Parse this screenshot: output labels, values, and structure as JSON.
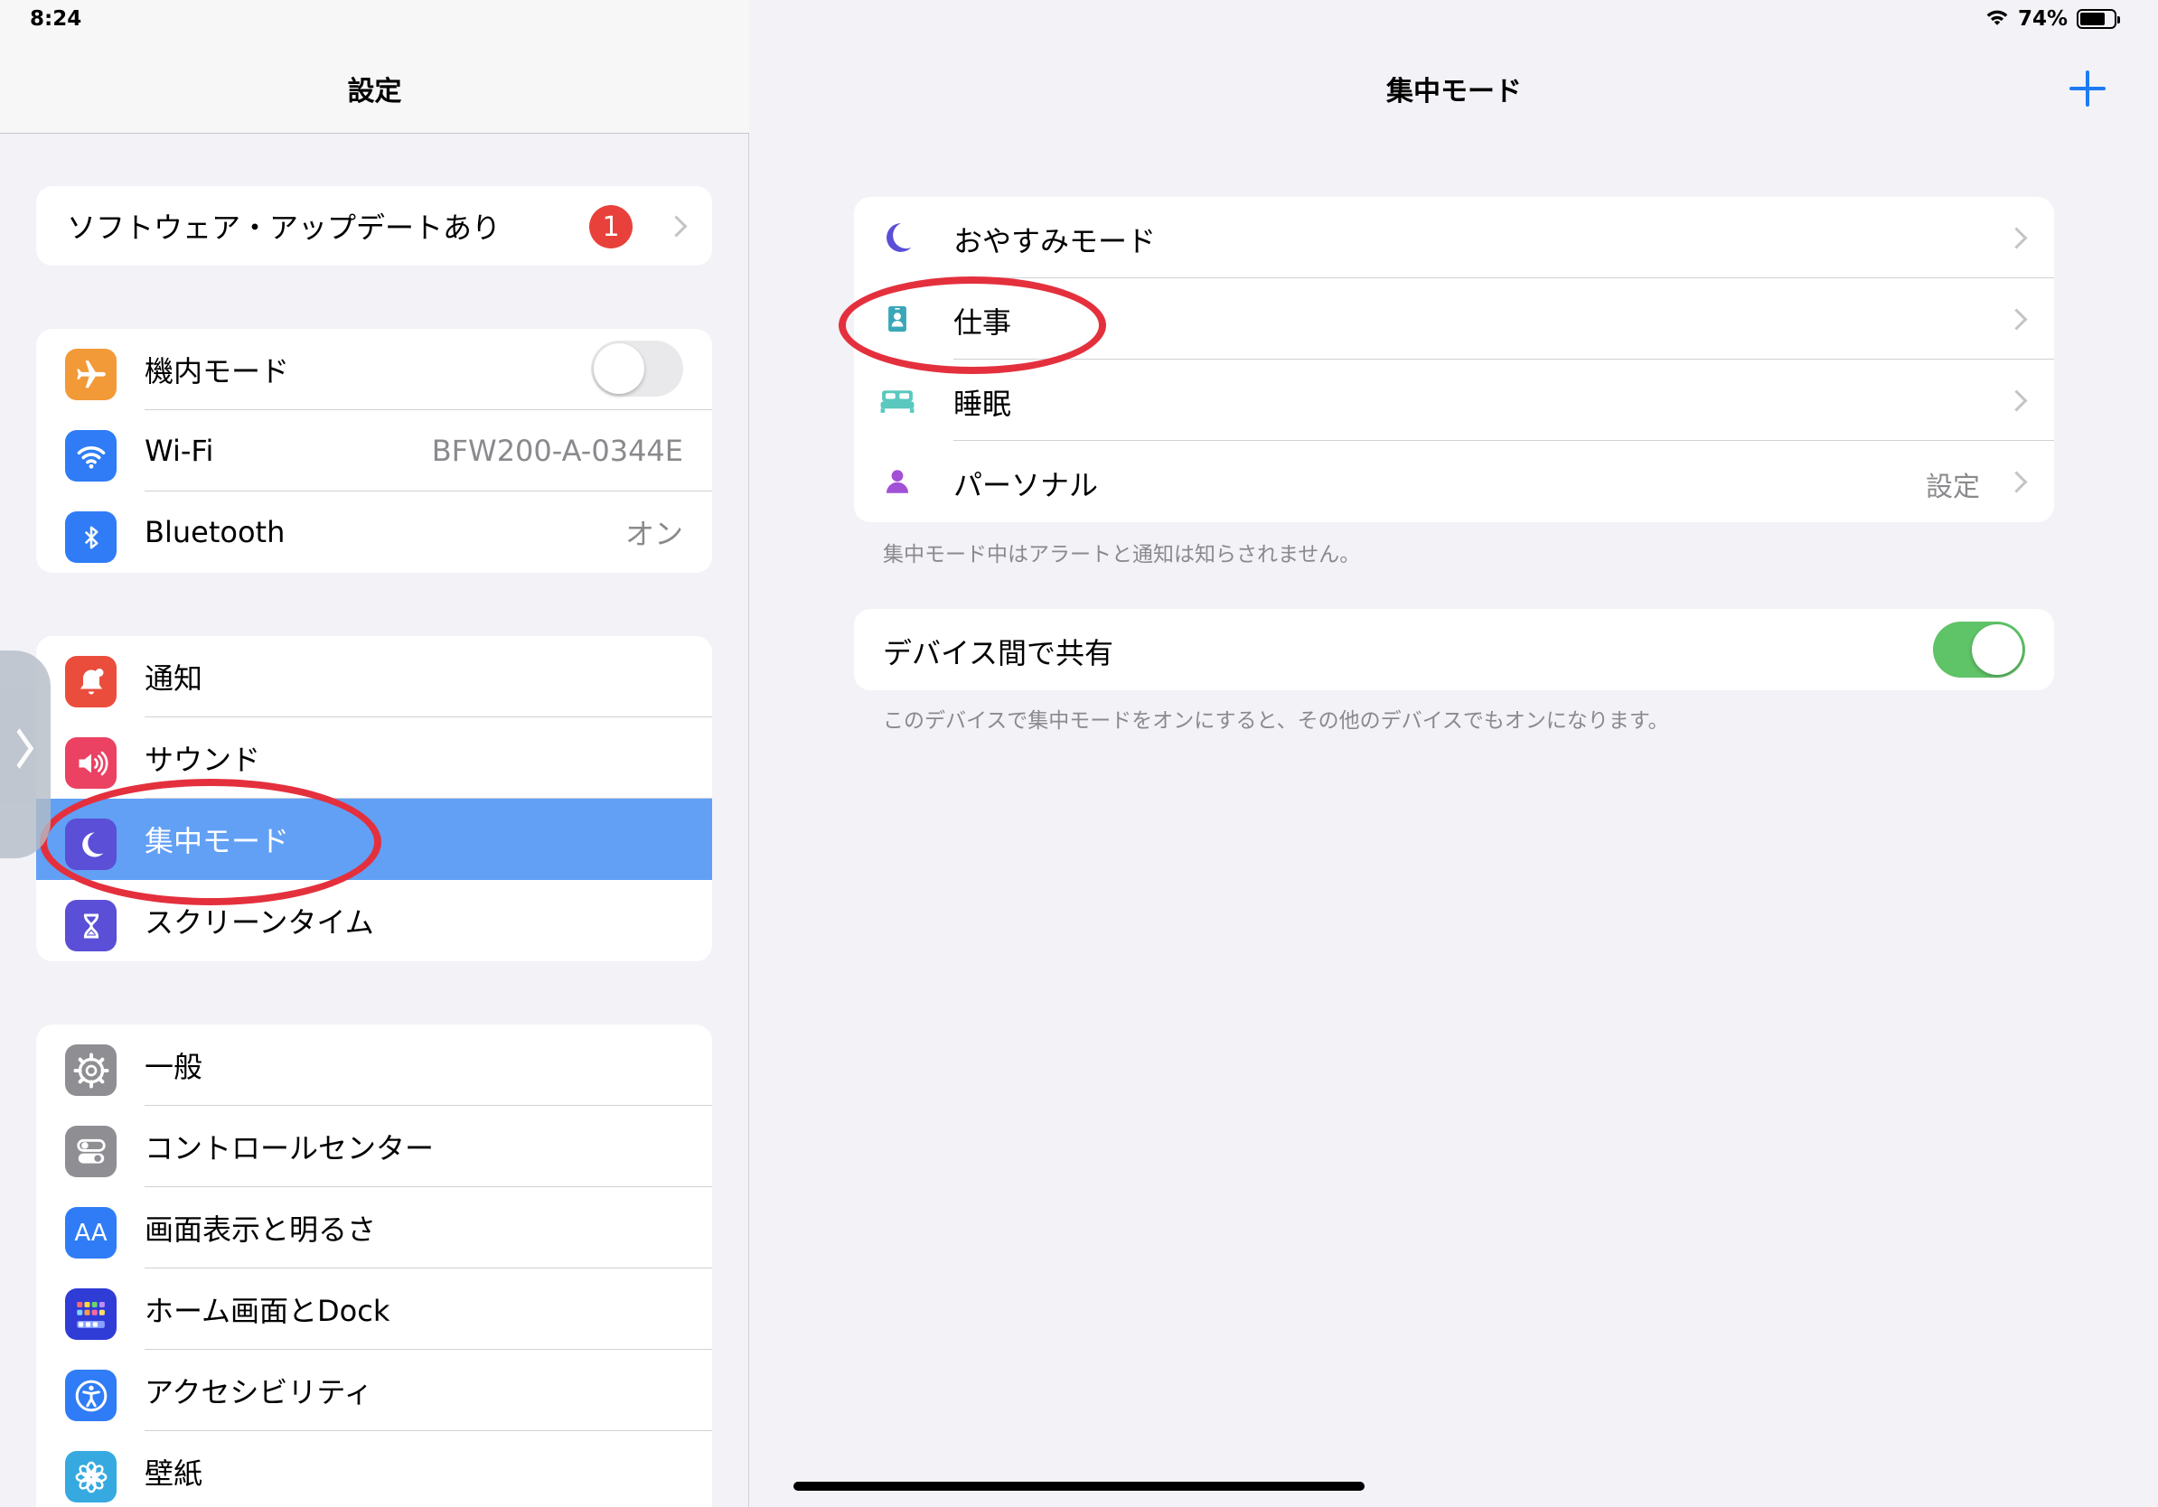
{
  "status": {
    "time": "8:24",
    "battery": "74%"
  },
  "sidebar": {
    "title": "設定",
    "update": {
      "label": "ソフトウェア・アップデートあり",
      "badge": "1"
    },
    "connectivity": [
      {
        "label": "機内モード",
        "icon": "airplane-icon",
        "color": "#f29a38"
      },
      {
        "label": "Wi-Fi",
        "value": "BFW200-A-0344E",
        "icon": "wifi-icon",
        "color": "#2f7cf6"
      },
      {
        "label": "Bluetooth",
        "value": "オン",
        "icon": "bluetooth-icon",
        "color": "#2f7cf6"
      }
    ],
    "notifications": [
      {
        "label": "通知",
        "icon": "bell-icon",
        "color": "#eb4d3d"
      },
      {
        "label": "サウンド",
        "icon": "speaker-icon",
        "color": "#eb4162"
      },
      {
        "label": "集中モード",
        "icon": "moon-icon",
        "color": "#5a4fd6"
      },
      {
        "label": "スクリーンタイム",
        "icon": "hourglass-icon",
        "color": "#5a4fd6"
      }
    ],
    "general": [
      {
        "label": "一般",
        "icon": "gear-icon",
        "color": "#8e8e93"
      },
      {
        "label": "コントロールセンター",
        "icon": "switches-icon",
        "color": "#8e8e93"
      },
      {
        "label": "画面表示と明るさ",
        "icon": "text-size-icon",
        "glyph": "AA",
        "color": "#2f7cf6"
      },
      {
        "label": "ホーム画面とDock",
        "icon": "home-grid-icon",
        "color": "#2f3cd6"
      },
      {
        "label": "アクセシビリティ",
        "icon": "accessibility-icon",
        "color": "#2f7cf6"
      },
      {
        "label": "壁紙",
        "icon": "flower-icon",
        "color": "#36a9e0"
      }
    ]
  },
  "detail": {
    "title": "集中モード",
    "modes": [
      {
        "label": "おやすみモード",
        "icon": "moon-icon",
        "color": "#5a4fd6"
      },
      {
        "label": "仕事",
        "icon": "id-badge-icon",
        "color": "#3aa7b8"
      },
      {
        "label": "睡眠",
        "icon": "bed-icon",
        "color": "#5ac8be"
      },
      {
        "label": "パーソナル",
        "value": "設定",
        "icon": "person-icon",
        "color": "#a251d6"
      }
    ],
    "modes_footer": "集中モード中はアラートと通知は知らされません。",
    "share": {
      "label": "デバイス間で共有",
      "on": true
    },
    "share_footer": "このデバイスで集中モードをオンにすると、その他のデバイスでもオンになります。"
  }
}
